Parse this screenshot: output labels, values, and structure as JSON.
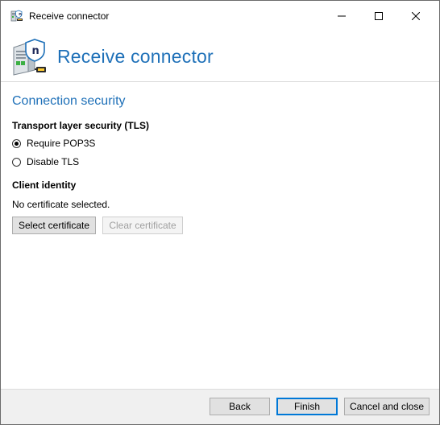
{
  "window": {
    "title": "Receive connector",
    "icon": "server-connector-icon",
    "controls": {
      "minimize_icon": "minimize-icon",
      "maximize_icon": "maximize-icon",
      "close_icon": "close-icon"
    }
  },
  "header": {
    "title": "Receive connector",
    "icon": "server-shield-icon",
    "title_color": "#1e70b8"
  },
  "section": {
    "title": "Connection security",
    "tls": {
      "label": "Transport layer security (TLS)",
      "options": [
        {
          "label": "Require POP3S",
          "selected": true
        },
        {
          "label": "Disable TLS",
          "selected": false
        }
      ]
    },
    "client_identity": {
      "label": "Client identity",
      "status": "No certificate selected.",
      "select_button": "Select certificate",
      "clear_button": "Clear certificate",
      "clear_enabled": false
    }
  },
  "footer": {
    "back": "Back",
    "finish": "Finish",
    "cancel": "Cancel and close"
  }
}
